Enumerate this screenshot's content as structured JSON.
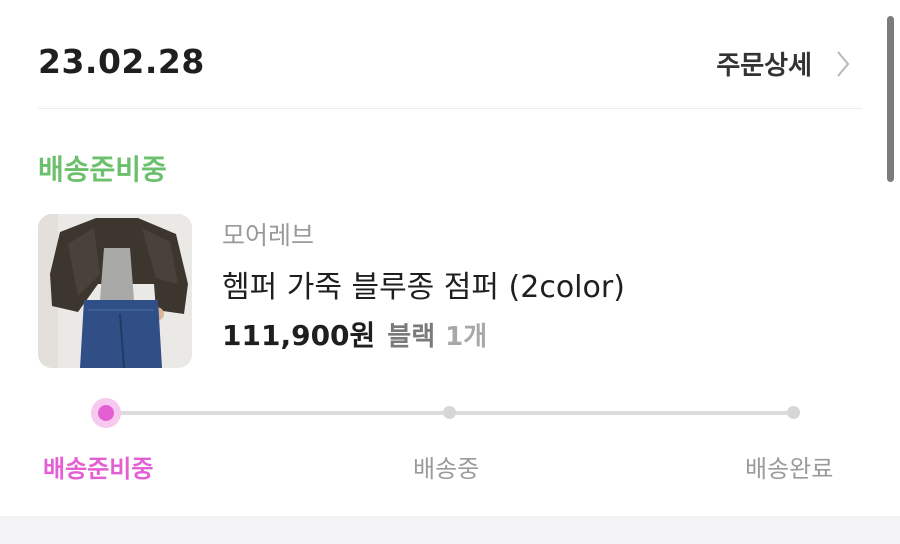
{
  "order": {
    "date": "23.02.28",
    "detail_label": "주문상세",
    "status": "배송준비중"
  },
  "product": {
    "brand": "모어레브",
    "name": "헴퍼 가죽 블루종 점퍼 (2color)",
    "price": "111,900원",
    "color": "블랙",
    "quantity": "1개",
    "thumbnail_icon": "leather-jacket-photo"
  },
  "progress": {
    "steps": [
      "배송준비중",
      "배송중",
      "배송완료"
    ],
    "current_step": 0
  },
  "colors": {
    "status_green": "#6cc06c",
    "active_pink": "#e35fd3"
  }
}
